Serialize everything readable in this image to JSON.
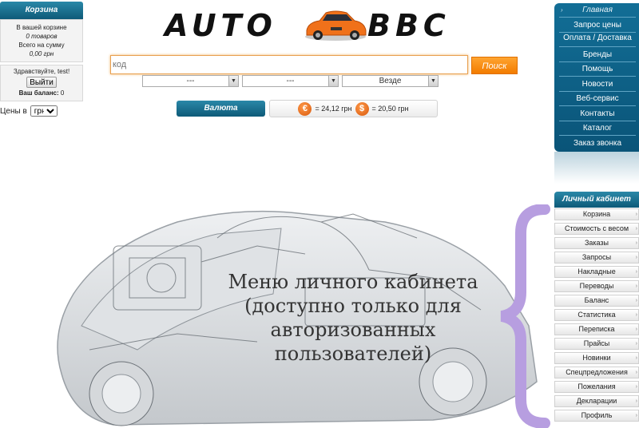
{
  "cart": {
    "title": "Корзина",
    "line1": "В вашей корзине",
    "line2": "0 товаров",
    "line3": "Всего на сумму",
    "line4": "0,00 грн"
  },
  "user": {
    "greeting": "Здравствуйте, test!",
    "logout_label": "Выйти",
    "balance_label": "Ваш баланс:",
    "balance_value": "0"
  },
  "prices": {
    "label": "Цены в",
    "currency_selected": "грн"
  },
  "logo": {
    "word1": "AUTO",
    "word2": "BBC"
  },
  "search": {
    "placeholder": "код",
    "button_label": "Поиск",
    "select1": "---",
    "select2": "---",
    "select3": "Везде"
  },
  "currency": {
    "button_label": "Валюта",
    "euro_symbol": "€",
    "euro_rate": "= 24,12 грн",
    "usd_symbol": "$",
    "usd_rate": "= 20,50 грн"
  },
  "nav": {
    "items": [
      {
        "label": "Главная"
      },
      {
        "label": "Запрос цены"
      },
      {
        "label": "Оплата / Доставка"
      },
      {
        "label": "Бренды"
      },
      {
        "label": "Помощь"
      },
      {
        "label": "Новости"
      },
      {
        "label": "Веб-сервис"
      },
      {
        "label": "Контакты"
      },
      {
        "label": "Каталог"
      },
      {
        "label": "Заказ звонка"
      }
    ]
  },
  "cabinet": {
    "title": "Личный кабинет",
    "items": [
      {
        "label": "Корзина"
      },
      {
        "label": "Стоимость с весом"
      },
      {
        "label": "Заказы"
      },
      {
        "label": "Запросы"
      },
      {
        "label": "Накладные"
      },
      {
        "label": "Переводы"
      },
      {
        "label": "Баланс"
      },
      {
        "label": "Статистика"
      },
      {
        "label": "Переписка"
      },
      {
        "label": "Прайсы"
      },
      {
        "label": "Новинки"
      },
      {
        "label": "Спецпредложения"
      },
      {
        "label": "Пожелания"
      },
      {
        "label": "Декларации"
      },
      {
        "label": "Профиль"
      }
    ]
  },
  "annotation": {
    "line1": "Меню личного кабинета",
    "line2": "(доступно только для",
    "line3": "авторизованных",
    "line4": "пользователей)"
  },
  "colors": {
    "accent_blue": "#0e5a78",
    "accent_orange": "#f27c00",
    "brace": "#b79ee0"
  }
}
